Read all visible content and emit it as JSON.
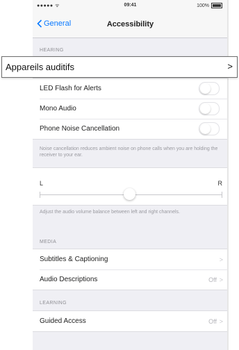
{
  "status_bar": {
    "signal": "●●●●● ᯤ",
    "time": "09:41",
    "battery": "100%"
  },
  "nav": {
    "back_label": "General",
    "title": "Accessibility"
  },
  "hearing": {
    "header": "HEARING",
    "callout_label": "Appareils auditifs",
    "callout_chevron": ">",
    "rows": [
      {
        "label": "LED Flash for Alerts"
      },
      {
        "label": "Mono Audio"
      },
      {
        "label": "Phone Noise Cancellation"
      }
    ],
    "note": "Noise cancellation reduces ambient noise on phone calls when you are holding the receiver to your ear."
  },
  "balance": {
    "left": "L",
    "right": "R",
    "value": 0.5,
    "note": "Adjust the audio volume balance between left and right channels."
  },
  "media": {
    "header": "MEDIA",
    "rows": [
      {
        "label": "Subtitles & Captioning",
        "detail": "",
        "chevron": ">"
      },
      {
        "label": "Audio Descriptions",
        "detail": "Off",
        "chevron": ">"
      }
    ]
  },
  "learning": {
    "header": "LEARNING",
    "rows": [
      {
        "label": "Guided Access",
        "detail": "Off",
        "chevron": ">"
      }
    ]
  }
}
